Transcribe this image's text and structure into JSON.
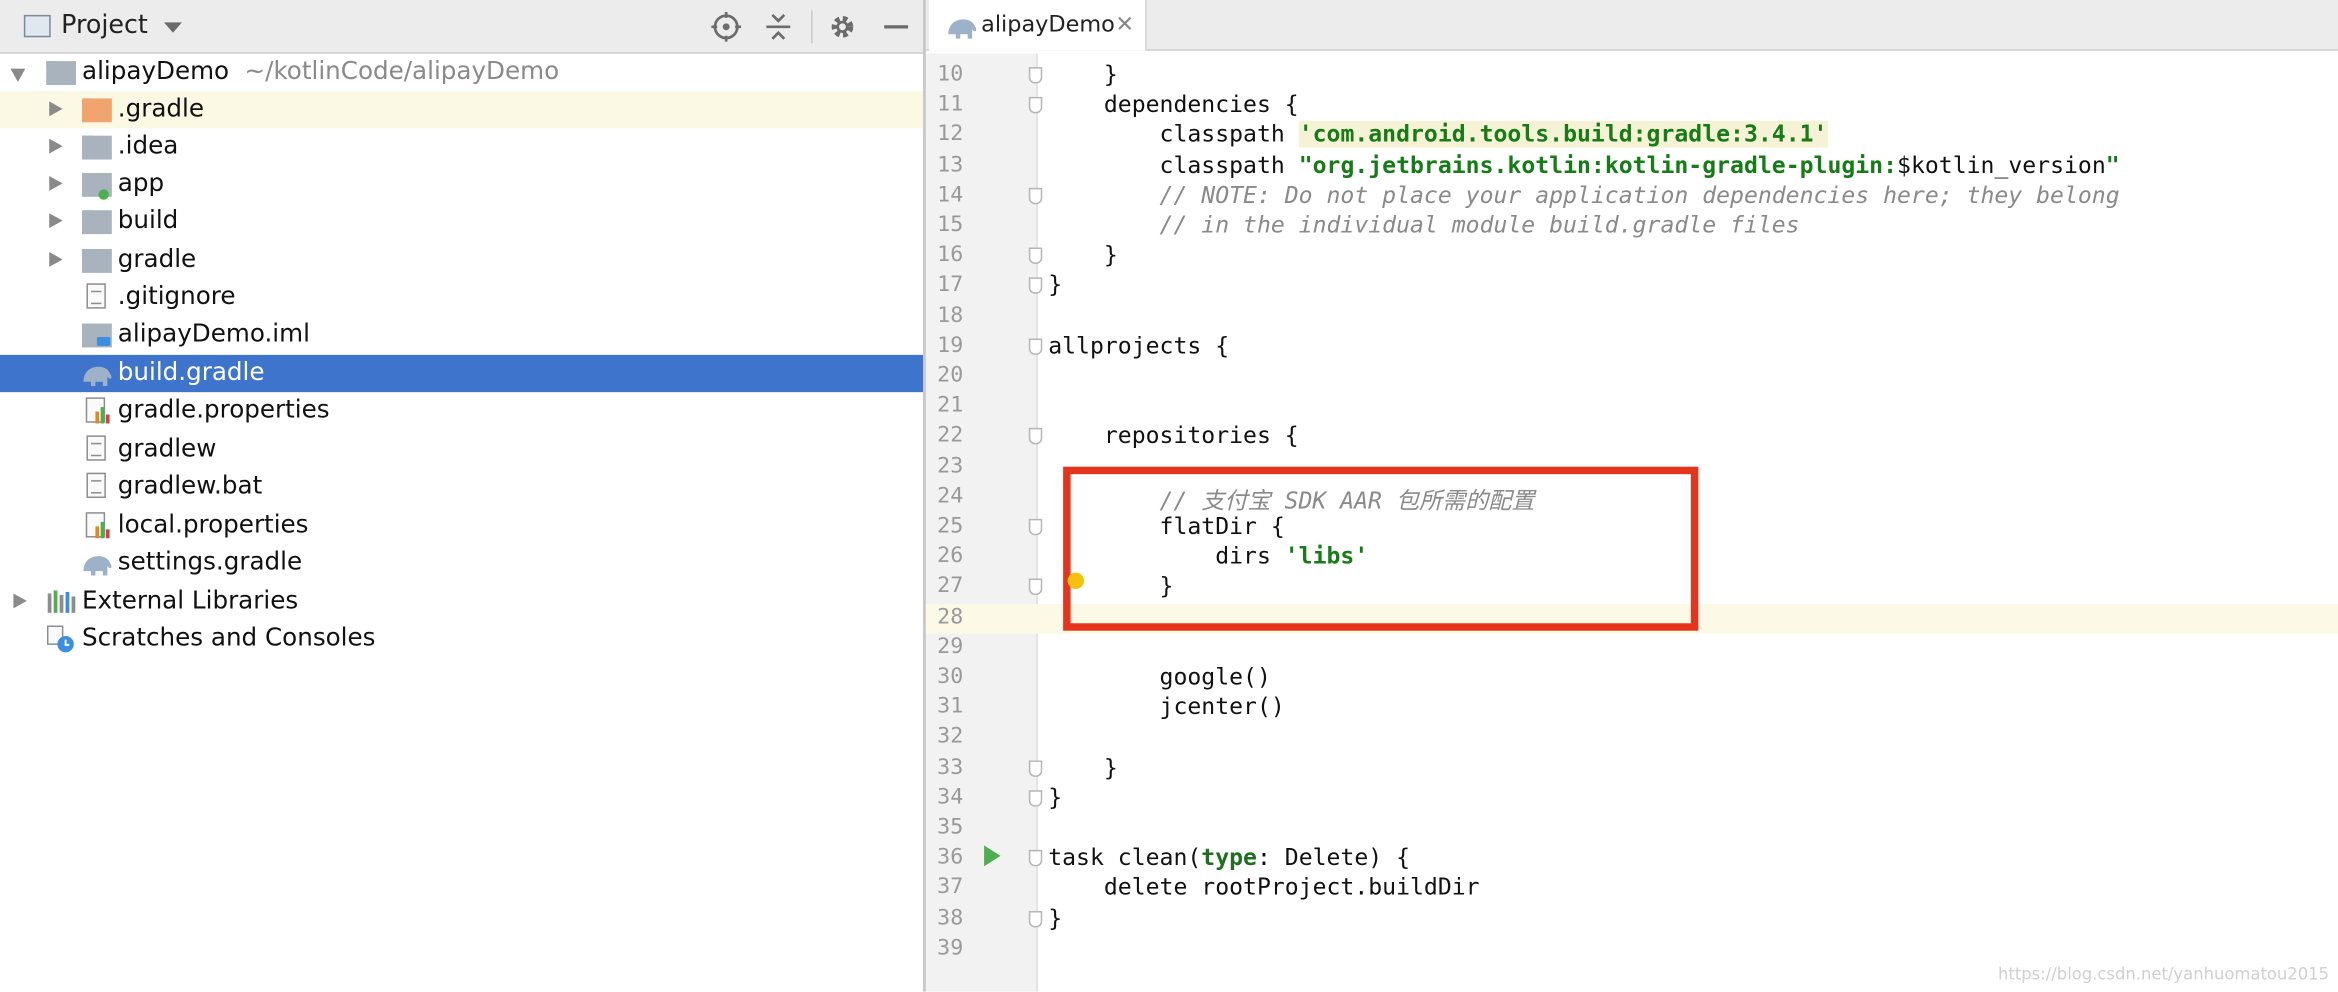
{
  "project_panel": {
    "title": "Project",
    "tree": [
      {
        "label": "alipayDemo",
        "sub": "~/kotlinCode/alipayDemo",
        "icon": "module-folder-icon"
      },
      {
        "label": ".gradle",
        "icon": "folder-orange-icon"
      },
      {
        "label": ".idea",
        "icon": "folder-icon"
      },
      {
        "label": "app",
        "icon": "module-folder-icon"
      },
      {
        "label": "build",
        "icon": "folder-icon"
      },
      {
        "label": "gradle",
        "icon": "folder-icon"
      },
      {
        "label": ".gitignore",
        "icon": "text-file-icon"
      },
      {
        "label": "alipayDemo.iml",
        "icon": "module-file-icon"
      },
      {
        "label": "build.gradle",
        "icon": "gradle-elephant-icon"
      },
      {
        "label": "gradle.properties",
        "icon": "properties-file-icon"
      },
      {
        "label": "gradlew",
        "icon": "text-file-icon"
      },
      {
        "label": "gradlew.bat",
        "icon": "text-file-icon"
      },
      {
        "label": "local.properties",
        "icon": "properties-file-icon"
      },
      {
        "label": "settings.gradle",
        "icon": "gradle-elephant-icon"
      },
      {
        "label": "External Libraries",
        "icon": "libraries-icon"
      },
      {
        "label": "Scratches and Consoles",
        "icon": "scratches-icon"
      }
    ]
  },
  "editor": {
    "tab_label": "alipayDemo",
    "tab_close": "✕",
    "lines": [
      {
        "n": "10",
        "t": "    }"
      },
      {
        "n": "11",
        "t": "    dependencies {"
      },
      {
        "n": "12",
        "pre": "        classpath ",
        "str": "'com.android.tools.build:gradle:3.4.1'"
      },
      {
        "n": "13",
        "pre": "        classpath ",
        "str2a": "\"org.jetbrains.kotlin:kotlin-gradle-plugin:",
        "plain": "$kotlin_version",
        "str2b": "\""
      },
      {
        "n": "14",
        "cmt": "        // NOTE: Do not place your application dependencies here; they belong"
      },
      {
        "n": "15",
        "cmt": "        // in the individual module build.gradle files"
      },
      {
        "n": "16",
        "t": "    }"
      },
      {
        "n": "17",
        "t": "}"
      },
      {
        "n": "18",
        "t": ""
      },
      {
        "n": "19",
        "t": "allprojects {"
      },
      {
        "n": "20",
        "t": ""
      },
      {
        "n": "21",
        "t": ""
      },
      {
        "n": "22",
        "t": "    repositories {"
      },
      {
        "n": "23",
        "t": ""
      },
      {
        "n": "24",
        "cmt": "        // 支付宝 SDK AAR 包所需的配置"
      },
      {
        "n": "25",
        "t": "        flatDir {"
      },
      {
        "n": "26",
        "pre": "            dirs ",
        "str": "'libs'"
      },
      {
        "n": "27",
        "t": "        }"
      },
      {
        "n": "28",
        "t": ""
      },
      {
        "n": "29",
        "t": ""
      },
      {
        "n": "30",
        "t": "        google()"
      },
      {
        "n": "31",
        "t": "        jcenter()"
      },
      {
        "n": "32",
        "t": ""
      },
      {
        "n": "33",
        "t": "    }"
      },
      {
        "n": "34",
        "t": "}"
      },
      {
        "n": "35",
        "t": ""
      },
      {
        "n": "36",
        "pre": "task clean(",
        "named": "type",
        "post": ": Delete) {"
      },
      {
        "n": "37",
        "t": "    delete rootProject.buildDir"
      },
      {
        "n": "38",
        "t": "}"
      },
      {
        "n": "39",
        "t": ""
      }
    ]
  },
  "watermark": "https://blog.csdn.net/yanhuomatou2015",
  "colors": {
    "selection": "#3f74cd",
    "highlight_box": "#e5341b",
    "string": "#167c16"
  }
}
